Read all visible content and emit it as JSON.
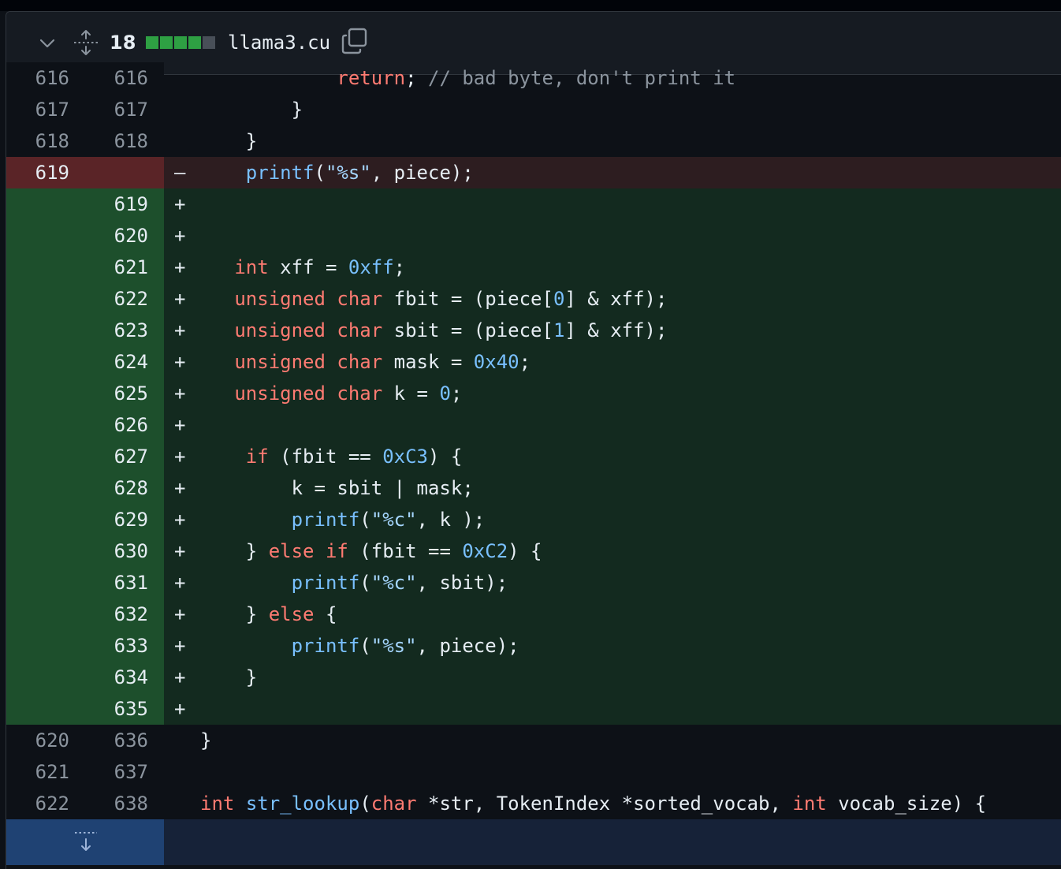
{
  "header": {
    "changes_count": "18",
    "filename": "llama3.cu",
    "diffstat": [
      "#2ea043",
      "#2ea043",
      "#2ea043",
      "#2ea043",
      "#484f58"
    ]
  },
  "icons": {
    "collapse": "chevron-down-icon",
    "expand_all": "unfold-icon",
    "copy_path": "copy-icon",
    "expand_down": "expand-down-icon"
  },
  "colors": {
    "addition_bg": "#132a1f",
    "addition_gutter": "#1d4f2c",
    "deletion_bg": "#2d1d20",
    "deletion_gutter": "#5a2427",
    "keyword": "#ff7b72",
    "function": "#79c0ff",
    "string": "#a5d6ff",
    "hunk_bg": "#162238"
  },
  "lines": [
    {
      "type": "ctx",
      "old": "616",
      "new": "616",
      "sign": "",
      "tokens": [
        [
          "t",
          "            "
        ],
        [
          "k",
          "return"
        ],
        [
          "t",
          "; "
        ],
        [
          "c",
          "// bad byte, don't print it"
        ]
      ]
    },
    {
      "type": "ctx",
      "old": "617",
      "new": "617",
      "sign": "",
      "tokens": [
        [
          "t",
          "        }"
        ]
      ]
    },
    {
      "type": "ctx",
      "old": "618",
      "new": "618",
      "sign": "",
      "tokens": [
        [
          "t",
          "    }"
        ]
      ]
    },
    {
      "type": "del",
      "old": "619",
      "new": "",
      "sign": "–",
      "tokens": [
        [
          "t",
          "    "
        ],
        [
          "f",
          "printf"
        ],
        [
          "t",
          "("
        ],
        [
          "s",
          "\"%s\""
        ],
        [
          "t",
          ", piece);"
        ]
      ]
    },
    {
      "type": "add",
      "old": "",
      "new": "619",
      "sign": "+",
      "tokens": []
    },
    {
      "type": "add",
      "old": "",
      "new": "620",
      "sign": "+",
      "tokens": []
    },
    {
      "type": "add",
      "old": "",
      "new": "621",
      "sign": "+",
      "tokens": [
        [
          "t",
          "   "
        ],
        [
          "k",
          "int"
        ],
        [
          "t",
          " xff = "
        ],
        [
          "n",
          "0xff"
        ],
        [
          "t",
          ";"
        ]
      ]
    },
    {
      "type": "add",
      "old": "",
      "new": "622",
      "sign": "+",
      "tokens": [
        [
          "t",
          "   "
        ],
        [
          "k",
          "unsigned"
        ],
        [
          "t",
          " "
        ],
        [
          "k",
          "char"
        ],
        [
          "t",
          " fbit = (piece["
        ],
        [
          "n",
          "0"
        ],
        [
          "t",
          "] & xff);"
        ]
      ]
    },
    {
      "type": "add",
      "old": "",
      "new": "623",
      "sign": "+",
      "tokens": [
        [
          "t",
          "   "
        ],
        [
          "k",
          "unsigned"
        ],
        [
          "t",
          " "
        ],
        [
          "k",
          "char"
        ],
        [
          "t",
          " sbit = (piece["
        ],
        [
          "n",
          "1"
        ],
        [
          "t",
          "] & xff);"
        ]
      ]
    },
    {
      "type": "add",
      "old": "",
      "new": "624",
      "sign": "+",
      "tokens": [
        [
          "t",
          "   "
        ],
        [
          "k",
          "unsigned"
        ],
        [
          "t",
          " "
        ],
        [
          "k",
          "char"
        ],
        [
          "t",
          " mask = "
        ],
        [
          "n",
          "0x40"
        ],
        [
          "t",
          ";"
        ]
      ]
    },
    {
      "type": "add",
      "old": "",
      "new": "625",
      "sign": "+",
      "tokens": [
        [
          "t",
          "   "
        ],
        [
          "k",
          "unsigned"
        ],
        [
          "t",
          " "
        ],
        [
          "k",
          "char"
        ],
        [
          "t",
          " k = "
        ],
        [
          "n",
          "0"
        ],
        [
          "t",
          ";"
        ]
      ]
    },
    {
      "type": "add",
      "old": "",
      "new": "626",
      "sign": "+",
      "tokens": []
    },
    {
      "type": "add",
      "old": "",
      "new": "627",
      "sign": "+",
      "tokens": [
        [
          "t",
          "    "
        ],
        [
          "k",
          "if"
        ],
        [
          "t",
          " (fbit == "
        ],
        [
          "n",
          "0xC3"
        ],
        [
          "t",
          ") {"
        ]
      ]
    },
    {
      "type": "add",
      "old": "",
      "new": "628",
      "sign": "+",
      "tokens": [
        [
          "t",
          "        k = sbit | mask;"
        ]
      ]
    },
    {
      "type": "add",
      "old": "",
      "new": "629",
      "sign": "+",
      "tokens": [
        [
          "t",
          "        "
        ],
        [
          "f",
          "printf"
        ],
        [
          "t",
          "("
        ],
        [
          "s",
          "\"%c\""
        ],
        [
          "t",
          ", k );"
        ]
      ]
    },
    {
      "type": "add",
      "old": "",
      "new": "630",
      "sign": "+",
      "tokens": [
        [
          "t",
          "    } "
        ],
        [
          "k",
          "else"
        ],
        [
          "t",
          " "
        ],
        [
          "k",
          "if"
        ],
        [
          "t",
          " (fbit == "
        ],
        [
          "n",
          "0xC2"
        ],
        [
          "t",
          ") {"
        ]
      ]
    },
    {
      "type": "add",
      "old": "",
      "new": "631",
      "sign": "+",
      "tokens": [
        [
          "t",
          "        "
        ],
        [
          "f",
          "printf"
        ],
        [
          "t",
          "("
        ],
        [
          "s",
          "\"%c\""
        ],
        [
          "t",
          ", sbit);"
        ]
      ]
    },
    {
      "type": "add",
      "old": "",
      "new": "632",
      "sign": "+",
      "tokens": [
        [
          "t",
          "    } "
        ],
        [
          "k",
          "else"
        ],
        [
          "t",
          " {"
        ]
      ]
    },
    {
      "type": "add",
      "old": "",
      "new": "633",
      "sign": "+",
      "tokens": [
        [
          "t",
          "        "
        ],
        [
          "f",
          "printf"
        ],
        [
          "t",
          "("
        ],
        [
          "s",
          "\"%s\""
        ],
        [
          "t",
          ", piece);"
        ]
      ]
    },
    {
      "type": "add",
      "old": "",
      "new": "634",
      "sign": "+",
      "tokens": [
        [
          "t",
          "    }"
        ]
      ]
    },
    {
      "type": "add",
      "old": "",
      "new": "635",
      "sign": "+",
      "tokens": []
    },
    {
      "type": "ctx",
      "old": "620",
      "new": "636",
      "sign": "",
      "tokens": [
        [
          "t",
          "}"
        ]
      ]
    },
    {
      "type": "ctx",
      "old": "621",
      "new": "637",
      "sign": "",
      "tokens": []
    },
    {
      "type": "ctx",
      "old": "622",
      "new": "638",
      "sign": "",
      "tokens": [
        [
          "k",
          "int"
        ],
        [
          "t",
          " "
        ],
        [
          "f",
          "str_lookup"
        ],
        [
          "t",
          "("
        ],
        [
          "k",
          "char"
        ],
        [
          "t",
          " *str, TokenIndex *sorted_vocab, "
        ],
        [
          "k",
          "int"
        ],
        [
          "t",
          " vocab_size) {"
        ]
      ]
    }
  ]
}
